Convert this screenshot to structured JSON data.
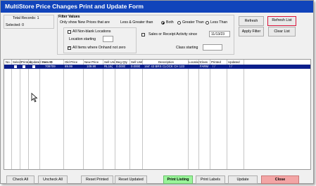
{
  "window": {
    "title": "MultiStore Price Changes Print and Update Form"
  },
  "summary": {
    "total_records": "Total Records: 1",
    "selected": "Selected: 0"
  },
  "filters": {
    "heading": "Filter Values",
    "only_show_label": "Only show New Prices that are",
    "less_greater_label": "Less & Greater than",
    "radio_options": [
      "Both",
      "Greater Than",
      "Less Than"
    ],
    "radio_selected": "Both",
    "all_nonblank_locations": "All Non-blank Locations",
    "location_starting_label": "Location starting",
    "all_items_onhand": "All Items where Onhand not zero",
    "sales_receipt_label": "Sales or Receipt Activity since",
    "sales_receipt_date": "11/13/23",
    "class_starting_label": "Class starting"
  },
  "buttons": {
    "refresh": "Refresh",
    "refresh_list": "Refresh List",
    "apply_filter": "Apply Filter",
    "clear_list": "Clear List",
    "check_all": "Check All",
    "uncheck_all": "Uncheck All",
    "reset_printed": "Reset Printed",
    "reset_updated": "Reset Updated",
    "print_listing": "Print Listing",
    "print_labels": "Print Labels",
    "update": "Update",
    "close": "Close"
  },
  "table": {
    "columns": [
      "No.",
      "Select",
      "Printed",
      "Updated",
      "Item ID",
      "Old Price",
      "New Price",
      "Sell Unit",
      "Beg Qty",
      "Sell Unit",
      "Description",
      "Location",
      "Class",
      "Printed",
      "Updated"
    ],
    "rows": [
      {
        "no": "",
        "item_id": "709709",
        "old_price": "89.99",
        "new_price": "109.99",
        "sell_unit": "RL16(",
        "beg_qty": "0.0000",
        "sell_unit2": "0.0000",
        "description": "164' 43 BRS CLOCK CH 123",
        "location": "",
        "class": "FARM",
        "printed": "/  /",
        "updated": "/  /"
      }
    ]
  },
  "colors": {
    "title_bar": "#1144bb",
    "selected_row": "#0c1f8c",
    "print_listing": "#9af59a",
    "close": "#f3a5a5",
    "focus_border": "#d8143a"
  }
}
